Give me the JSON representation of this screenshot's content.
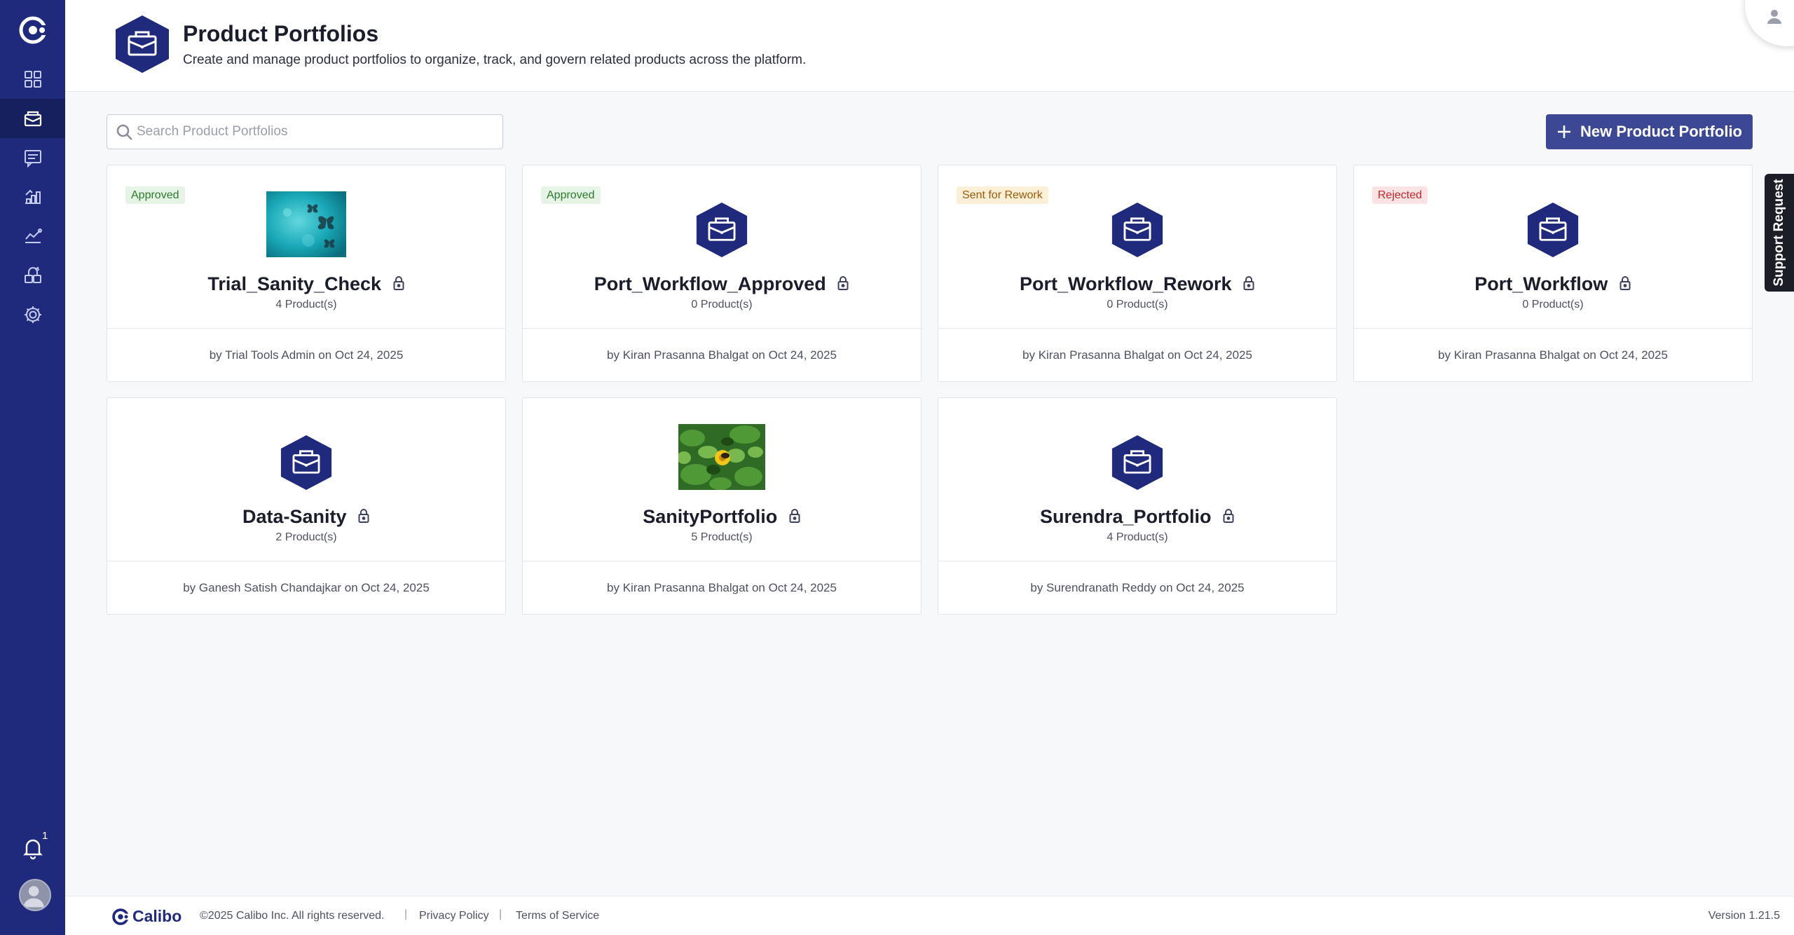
{
  "colors": {
    "sidebar": "#1f2a7c",
    "sidebar_active": "#16205f",
    "primary_button": "#3d4894",
    "portfolio_hex": "#1f2a7c",
    "approved": "#2d7a2d",
    "rework": "#9a5a08",
    "rejected": "#c0262d"
  },
  "sidebar": {
    "items": [
      {
        "icon": "dashboard-grid-icon",
        "active": false
      },
      {
        "icon": "product-portfolio-icon",
        "active": true
      },
      {
        "icon": "message-list-icon",
        "active": false
      },
      {
        "icon": "workflow-steps-icon",
        "active": false
      },
      {
        "icon": "analytics-line-icon",
        "active": false
      },
      {
        "icon": "integration-blocks-icon",
        "active": false
      },
      {
        "icon": "settings-gear-icon",
        "active": false
      }
    ],
    "notification_count": "1"
  },
  "header": {
    "title": "Product Portfolios",
    "subtitle": "Create and manage product portfolios to organize, track, and govern related products across the platform."
  },
  "search": {
    "placeholder": "Search Product Portfolios",
    "value": ""
  },
  "new_button_label": "New Product Portfolio",
  "support_label": "Support Request",
  "cards": [
    {
      "status": "Approved",
      "image": "turquoise-butterfly-photo",
      "name": "Trial_Sanity_Check",
      "count": "4 Product(s)",
      "meta": "by Trial Tools Admin on Oct 24, 2025"
    },
    {
      "status": "Approved",
      "image": "hex-briefcase-icon",
      "name": "Port_Workflow_Approved",
      "count": "0 Product(s)",
      "meta": "by Kiran Prasanna Bhalgat on Oct 24, 2025"
    },
    {
      "status": "Sent for Rework",
      "image": "hex-briefcase-icon",
      "name": "Port_Workflow_Rework",
      "count": "0 Product(s)",
      "meta": "by Kiran Prasanna Bhalgat on Oct 24, 2025"
    },
    {
      "status": "Rejected",
      "image": "hex-briefcase-icon",
      "name": "Port_Workflow",
      "count": "0 Product(s)",
      "meta": "by Kiran Prasanna Bhalgat on Oct 24, 2025"
    },
    {
      "status": "",
      "image": "hex-briefcase-icon",
      "name": "Data-Sanity",
      "count": "2 Product(s)",
      "meta": "by Ganesh Satish Chandajkar on Oct 24, 2025"
    },
    {
      "status": "",
      "image": "bee-on-flower-photo",
      "name": "SanityPortfolio",
      "count": "5 Product(s)",
      "meta": "by Kiran Prasanna Bhalgat on Oct 24, 2025"
    },
    {
      "status": "",
      "image": "hex-briefcase-icon",
      "name": "Surendra_Portfolio",
      "count": "4 Product(s)",
      "meta": "by Surendranath Reddy on Oct 24, 2025"
    }
  ],
  "footer": {
    "brand": "Calibo",
    "copyright": "©2025 Calibo Inc. All rights reserved.",
    "privacy": "Privacy Policy",
    "terms": "Terms of Service",
    "version": "Version 1.21.5"
  }
}
